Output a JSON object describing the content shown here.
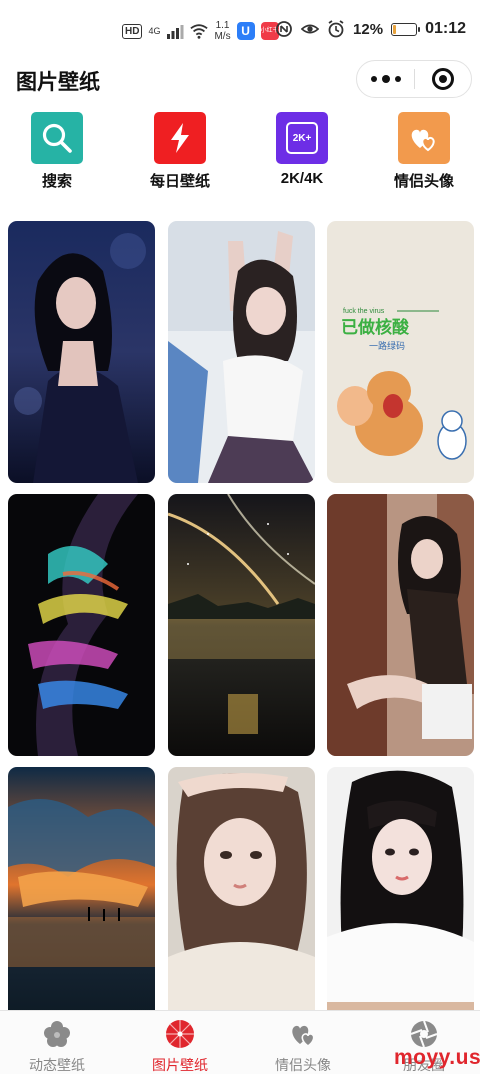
{
  "status_bar": {
    "hd": "HD",
    "signal": "4G",
    "speed_top": "1.1",
    "speed_bottom": "M/s",
    "app1": "U",
    "app2": "小红书",
    "battery_pct": "12%",
    "battery_level": 0.12,
    "time": "01:12"
  },
  "header": {
    "title": "图片壁纸"
  },
  "quick_categories": [
    {
      "label": "搜索",
      "color": "#26b3a5",
      "icon": "search-icon"
    },
    {
      "label": "每日壁纸",
      "color": "#ef1f22",
      "icon": "lightning-icon"
    },
    {
      "label": "2K/4K",
      "color": "#6d2ee6",
      "icon": "2k-badge-icon",
      "badge": "2K+"
    },
    {
      "label": "情侣头像",
      "color": "#f29a4d",
      "icon": "hearts-icon"
    }
  ],
  "wallpapers": [
    {
      "name": "wallpaper-girl-night-dress",
      "colors": [
        "#101b3c",
        "#2d3a6e",
        "#0b0f26"
      ]
    },
    {
      "name": "wallpaper-girl-white-top",
      "colors": [
        "#e8edf2",
        "#c7cfd9",
        "#6a7ea3"
      ]
    },
    {
      "name": "wallpaper-jerry-cartoon",
      "colors": [
        "#ece7dd",
        "#e5dfd2",
        "#e2dccf"
      ],
      "text_line1": "fuck the virus",
      "text_line2": "已做核酸",
      "text_line3": "一路绿码"
    },
    {
      "name": "wallpaper-abstract-neon",
      "colors": [
        "#0a0a0e",
        "#1b1428",
        "#050507"
      ]
    },
    {
      "name": "wallpaper-galaxy-lake",
      "colors": [
        "#121216",
        "#3a3220",
        "#0c0b0a"
      ]
    },
    {
      "name": "wallpaper-girl-sitting-chair",
      "colors": [
        "#6e3b2b",
        "#a06a52",
        "#d9c8bd"
      ]
    },
    {
      "name": "wallpaper-sunset-clouds",
      "colors": [
        "#14324f",
        "#d8692a",
        "#0d1b2a"
      ]
    },
    {
      "name": "wallpaper-girl-sweater",
      "colors": [
        "#d8d3cc",
        "#c9bfb4",
        "#e9e3da"
      ]
    },
    {
      "name": "wallpaper-girl-bangs",
      "colors": [
        "#f2f2f2",
        "#e3e3e3",
        "#cfcfcf"
      ]
    }
  ],
  "tab_bar": {
    "tabs": [
      {
        "label": "动态壁纸",
        "active": false,
        "icon": "flower-icon"
      },
      {
        "label": "图片壁纸",
        "active": true,
        "icon": "umbrella-icon"
      },
      {
        "label": "情侣头像",
        "active": false,
        "icon": "hearts-icon"
      },
      {
        "label": "朋友圈",
        "active": false,
        "icon": "aperture-icon"
      }
    ]
  },
  "watermark": "moyy.us"
}
